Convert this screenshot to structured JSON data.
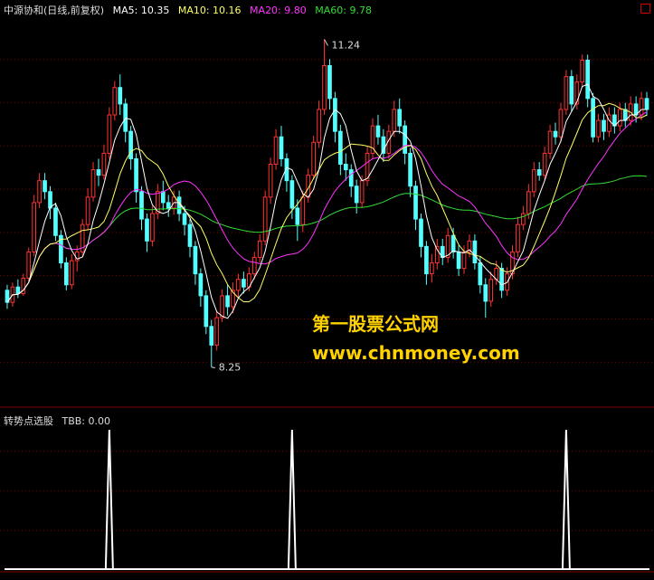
{
  "colors": {
    "background": "#000000",
    "up": "#ff3333",
    "down": "#54ffff",
    "ma5": "#ffffff",
    "ma10": "#ffff66",
    "ma20": "#ff33ff",
    "ma60": "#33dd33",
    "grid": "#800000",
    "tbb": "#ffffff",
    "watermark": "#ffd200"
  },
  "main_panel": {
    "stock": "中源协和(日线,前复权)",
    "indicators": [
      {
        "label": "MA5:",
        "value": "10.35",
        "color": "#ffffff"
      },
      {
        "label": "MA10:",
        "value": "10.16",
        "color": "#ffff66"
      },
      {
        "label": "MA20:",
        "value": "9.80",
        "color": "#ff33ff"
      },
      {
        "label": "MA60:",
        "value": "9.78",
        "color": "#33dd33"
      }
    ],
    "high_label": "11.24",
    "low_label": "8.25"
  },
  "sub_panel": {
    "title": "转势点选股",
    "indicator": "TBB:",
    "value": "0.00"
  },
  "watermark": {
    "line1": "第一股票公式网",
    "line2": "www.chnmoney.com"
  },
  "chart_data": [
    {
      "type": "candlestick",
      "ylim": [
        7.9,
        11.45
      ],
      "grid": true,
      "x": [
        1,
        2,
        3,
        4,
        5,
        6,
        7,
        8,
        9,
        10,
        11,
        12,
        13,
        14,
        15,
        16,
        17,
        18,
        19,
        20,
        21,
        22,
        23,
        24,
        25,
        26,
        27,
        28,
        29,
        30,
        31,
        32,
        33,
        34,
        35,
        36,
        37,
        38,
        39,
        40,
        41,
        42,
        43,
        44,
        45,
        46,
        47,
        48,
        49,
        50,
        51,
        52,
        53,
        54,
        55,
        56,
        57,
        58,
        59,
        60,
        61,
        62,
        63,
        64,
        65,
        66,
        67,
        68,
        69,
        70,
        71,
        72,
        73,
        74,
        75,
        76,
        77,
        78,
        79,
        80,
        81,
        82,
        83,
        84,
        85,
        86,
        87,
        88,
        89,
        90,
        91,
        92,
        93,
        94,
        95,
        96,
        97,
        98,
        99,
        100,
        101,
        102,
        103,
        104,
        105,
        106,
        107,
        108,
        109,
        110,
        111,
        112,
        113,
        114,
        115,
        116,
        117,
        118,
        119,
        120
      ],
      "candles": [
        [
          8.95,
          8.84,
          9.0,
          8.78
        ],
        [
          8.84,
          8.98,
          9.02,
          8.8
        ],
        [
          8.98,
          8.92,
          9.05,
          8.88
        ],
        [
          8.92,
          9.06,
          9.1,
          8.9
        ],
        [
          9.06,
          9.3,
          9.34,
          9.03
        ],
        [
          9.3,
          9.75,
          9.82,
          9.26
        ],
        [
          9.75,
          9.95,
          10.02,
          9.7
        ],
        [
          9.95,
          9.85,
          10.02,
          9.78
        ],
        [
          9.85,
          9.7,
          9.9,
          9.6
        ],
        [
          9.7,
          9.45,
          9.75,
          9.4
        ],
        [
          9.45,
          9.2,
          9.5,
          9.15
        ],
        [
          9.2,
          9.0,
          9.25,
          8.95
        ],
        [
          9.0,
          9.22,
          9.28,
          8.96
        ],
        [
          9.22,
          9.3,
          9.36,
          9.12
        ],
        [
          9.3,
          9.55,
          9.6,
          9.27
        ],
        [
          9.55,
          9.8,
          9.88,
          9.5
        ],
        [
          9.8,
          10.05,
          10.12,
          9.76
        ],
        [
          10.05,
          10.0,
          10.15,
          9.9
        ],
        [
          10.0,
          10.2,
          10.28,
          9.96
        ],
        [
          10.2,
          10.55,
          10.62,
          10.15
        ],
        [
          10.55,
          10.8,
          10.86,
          10.5
        ],
        [
          10.8,
          10.65,
          10.92,
          10.55
        ],
        [
          10.65,
          10.4,
          10.7,
          10.3
        ],
        [
          10.4,
          10.15,
          10.45,
          10.05
        ],
        [
          10.15,
          9.85,
          10.2,
          9.75
        ],
        [
          9.85,
          9.6,
          9.9,
          9.5
        ],
        [
          9.6,
          9.4,
          9.65,
          9.3
        ],
        [
          9.4,
          9.65,
          9.72,
          9.35
        ],
        [
          9.65,
          9.85,
          9.92,
          9.6
        ],
        [
          9.85,
          9.75,
          9.95,
          9.68
        ],
        [
          9.75,
          9.7,
          9.82,
          9.62
        ],
        [
          9.7,
          9.8,
          9.86,
          9.64
        ],
        [
          9.8,
          9.65,
          9.86,
          9.58
        ],
        [
          9.65,
          9.55,
          9.72,
          9.45
        ],
        [
          9.55,
          9.35,
          9.6,
          9.25
        ],
        [
          9.35,
          9.1,
          9.4,
          9.0
        ],
        [
          9.1,
          8.9,
          9.15,
          8.8
        ],
        [
          8.9,
          8.62,
          8.95,
          8.55
        ],
        [
          8.62,
          8.45,
          8.68,
          8.25
        ],
        [
          8.45,
          8.7,
          8.76,
          8.4
        ],
        [
          8.7,
          8.9,
          8.96,
          8.66
        ],
        [
          8.9,
          8.8,
          9.0,
          8.72
        ],
        [
          8.8,
          8.95,
          9.02,
          8.74
        ],
        [
          8.95,
          9.05,
          9.1,
          8.88
        ],
        [
          9.05,
          8.98,
          9.12,
          8.92
        ],
        [
          8.98,
          9.1,
          9.16,
          8.94
        ],
        [
          9.1,
          9.25,
          9.3,
          9.05
        ],
        [
          9.25,
          9.4,
          9.46,
          9.2
        ],
        [
          9.4,
          9.8,
          9.86,
          9.36
        ],
        [
          9.8,
          10.1,
          10.16,
          9.74
        ],
        [
          10.1,
          10.35,
          10.42,
          10.05
        ],
        [
          10.35,
          10.15,
          10.45,
          10.08
        ],
        [
          10.15,
          9.95,
          10.2,
          9.85
        ],
        [
          9.95,
          9.7,
          10.0,
          9.6
        ],
        [
          9.7,
          9.55,
          9.78,
          9.4
        ],
        [
          9.55,
          9.8,
          9.86,
          9.48
        ],
        [
          9.8,
          10.0,
          10.06,
          9.75
        ],
        [
          10.0,
          10.3,
          10.36,
          9.96
        ],
        [
          10.3,
          10.6,
          10.68,
          10.25
        ],
        [
          10.6,
          11.0,
          11.24,
          10.55
        ],
        [
          11.0,
          10.7,
          11.06,
          10.6
        ],
        [
          10.7,
          10.4,
          10.76,
          10.3
        ],
        [
          10.4,
          10.1,
          10.46,
          10.0
        ],
        [
          10.1,
          10.05,
          10.2,
          9.95
        ],
        [
          10.05,
          9.9,
          10.1,
          9.8
        ],
        [
          9.9,
          9.75,
          9.96,
          9.65
        ],
        [
          9.75,
          9.95,
          10.0,
          9.7
        ],
        [
          9.95,
          10.2,
          10.26,
          9.9
        ],
        [
          10.2,
          10.45,
          10.52,
          10.15
        ],
        [
          10.45,
          10.35,
          10.55,
          10.28
        ],
        [
          10.35,
          10.2,
          10.42,
          10.12
        ],
        [
          10.2,
          10.4,
          10.46,
          10.15
        ],
        [
          10.4,
          10.6,
          10.68,
          10.35
        ],
        [
          10.6,
          10.45,
          10.7,
          10.38
        ],
        [
          10.45,
          10.2,
          10.5,
          10.1
        ],
        [
          10.2,
          9.9,
          10.25,
          9.8
        ],
        [
          9.9,
          9.6,
          9.95,
          9.5
        ],
        [
          9.6,
          9.35,
          9.65,
          9.25
        ],
        [
          9.35,
          9.1,
          9.4,
          9.0
        ],
        [
          9.1,
          9.2,
          9.28,
          9.02
        ],
        [
          9.2,
          9.35,
          9.42,
          9.14
        ],
        [
          9.35,
          9.25,
          9.42,
          9.18
        ],
        [
          9.25,
          9.45,
          9.52,
          9.2
        ],
        [
          9.45,
          9.3,
          9.52,
          9.24
        ],
        [
          9.3,
          9.15,
          9.36,
          9.08
        ],
        [
          9.15,
          9.3,
          9.36,
          9.1
        ],
        [
          9.3,
          9.4,
          9.46,
          9.25
        ],
        [
          9.4,
          9.2,
          9.46,
          9.14
        ],
        [
          9.2,
          9.0,
          9.26,
          8.92
        ],
        [
          9.0,
          8.85,
          9.06,
          8.7
        ],
        [
          8.85,
          9.05,
          9.12,
          8.8
        ],
        [
          9.05,
          9.15,
          9.22,
          9.0
        ],
        [
          9.15,
          8.95,
          9.2,
          8.88
        ],
        [
          8.95,
          9.1,
          9.16,
          8.9
        ],
        [
          9.1,
          9.3,
          9.36,
          9.05
        ],
        [
          9.3,
          9.55,
          9.62,
          9.25
        ],
        [
          9.55,
          9.65,
          9.72,
          9.5
        ],
        [
          9.65,
          9.85,
          9.92,
          9.6
        ],
        [
          9.85,
          10.05,
          10.12,
          9.8
        ],
        [
          10.05,
          10.0,
          10.12,
          9.95
        ],
        [
          10.0,
          10.2,
          10.26,
          9.95
        ],
        [
          10.2,
          10.4,
          10.46,
          10.15
        ],
        [
          10.4,
          10.35,
          10.48,
          10.28
        ],
        [
          10.35,
          10.6,
          10.66,
          10.3
        ],
        [
          10.6,
          10.9,
          10.96,
          10.55
        ],
        [
          10.9,
          10.65,
          10.96,
          10.58
        ],
        [
          10.65,
          10.85,
          10.92,
          10.6
        ],
        [
          10.85,
          11.05,
          11.1,
          10.8
        ],
        [
          11.05,
          10.7,
          11.1,
          10.62
        ],
        [
          10.7,
          10.35,
          10.75,
          10.3
        ],
        [
          10.35,
          10.5,
          10.56,
          10.3
        ],
        [
          10.5,
          10.4,
          10.56,
          10.32
        ],
        [
          10.4,
          10.55,
          10.62,
          10.35
        ],
        [
          10.55,
          10.45,
          10.62,
          10.38
        ],
        [
          10.45,
          10.6,
          10.66,
          10.4
        ],
        [
          10.6,
          10.5,
          10.66,
          10.44
        ],
        [
          10.5,
          10.65,
          10.72,
          10.45
        ],
        [
          10.65,
          10.55,
          10.72,
          10.48
        ],
        [
          10.55,
          10.7,
          10.76,
          10.5
        ],
        [
          10.7,
          10.6,
          10.76,
          10.54
        ]
      ],
      "ma_windows": {
        "ma5": 5,
        "ma10": 10,
        "ma20": 20,
        "ma60": 60
      },
      "annotations": [
        {
          "text": "11.24",
          "x": 60,
          "y": 11.24
        },
        {
          "text": "8.25",
          "x": 39,
          "y": 8.25
        }
      ]
    },
    {
      "type": "line",
      "name": "TBB",
      "ylim": [
        0,
        1
      ],
      "x_count": 120,
      "spikes": [
        {
          "x": 20,
          "y": 1
        },
        {
          "x": 54,
          "y": 1
        },
        {
          "x": 105,
          "y": 1
        }
      ]
    }
  ]
}
